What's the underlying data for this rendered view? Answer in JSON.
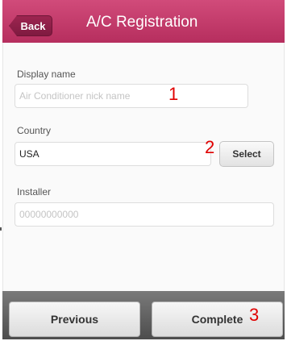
{
  "header": {
    "back_label": "Back",
    "title": "A/C Registration"
  },
  "form": {
    "display_name": {
      "label": "Display name",
      "placeholder": "Air Conditioner nick name",
      "value": ""
    },
    "country": {
      "label": "Country",
      "value": "USA",
      "select_label": "Select"
    },
    "installer": {
      "label": "Installer",
      "placeholder": "00000000000",
      "value": ""
    }
  },
  "footer": {
    "previous_label": "Previous",
    "complete_label": "Complete"
  },
  "annotations": {
    "marker_1": "1",
    "marker_2": "2",
    "marker_3": "3"
  },
  "colors": {
    "header": "#c13a69",
    "annotation": "#e00000",
    "bottom_bar": "#5e5e5e"
  }
}
